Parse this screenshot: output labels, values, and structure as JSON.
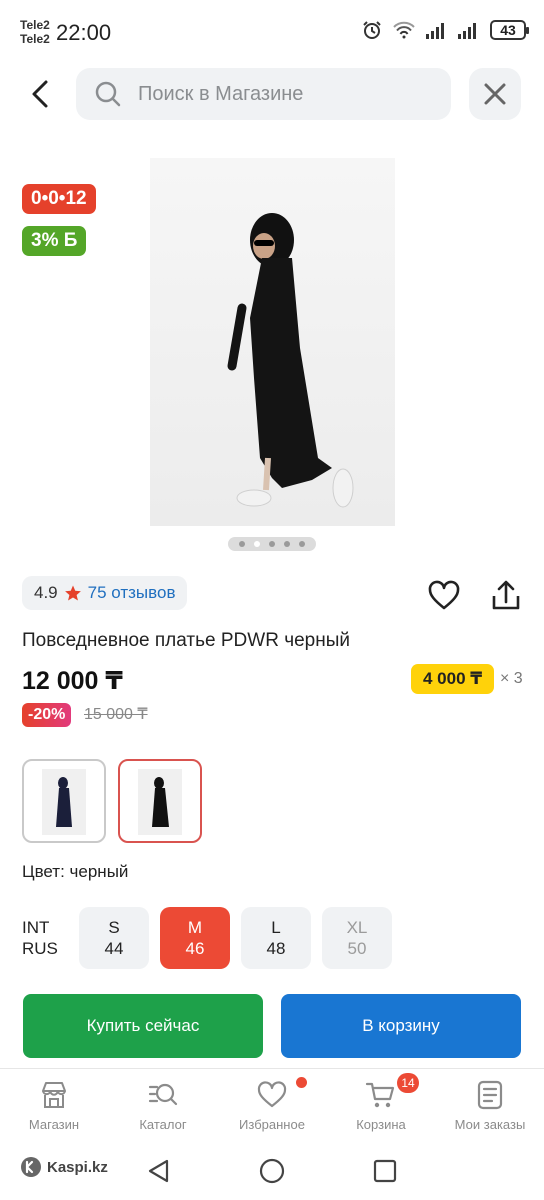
{
  "status_bar": {
    "carrier_1": "Tele2",
    "carrier_2": "Tele2",
    "time": "22:00",
    "battery": "43"
  },
  "search": {
    "placeholder": "Поиск в Магазине"
  },
  "badges": {
    "promo": "0•0•12",
    "bonus": "3% Б"
  },
  "gallery": {
    "image_count": 5,
    "active_index": 1
  },
  "rating": {
    "value": "4.9",
    "reviews": "75 отзывов"
  },
  "product": {
    "title": "Повседневное платье PDWR черный",
    "price": "12 000 ₸",
    "installment": "4 000 ₸",
    "installment_multiplier": "× 3",
    "discount": "-20%",
    "old_price": "15 000 ₸"
  },
  "color": {
    "label": "Цвет: черный"
  },
  "sizes": {
    "int_label": "INT",
    "rus_label": "RUS",
    "options": [
      {
        "int": "S",
        "rus": "44"
      },
      {
        "int": "M",
        "rus": "46"
      },
      {
        "int": "L",
        "rus": "48"
      },
      {
        "int": "XL",
        "rus": "50"
      }
    ]
  },
  "actions": {
    "buy_now": "Купить сейчас",
    "to_cart": "В корзину"
  },
  "bottom_nav": {
    "items": [
      {
        "label": "Магазин"
      },
      {
        "label": "Каталог"
      },
      {
        "label": "Избранное"
      },
      {
        "label": "Корзина"
      },
      {
        "label": "Мои заказы"
      }
    ],
    "cart_count": "14"
  },
  "system": {
    "brand": "Kaspi.kz"
  },
  "colors": {
    "accent_red": "#ec4a35",
    "green": "#1ea14a",
    "blue": "#1976d2",
    "yellow": "#ffd20a"
  }
}
